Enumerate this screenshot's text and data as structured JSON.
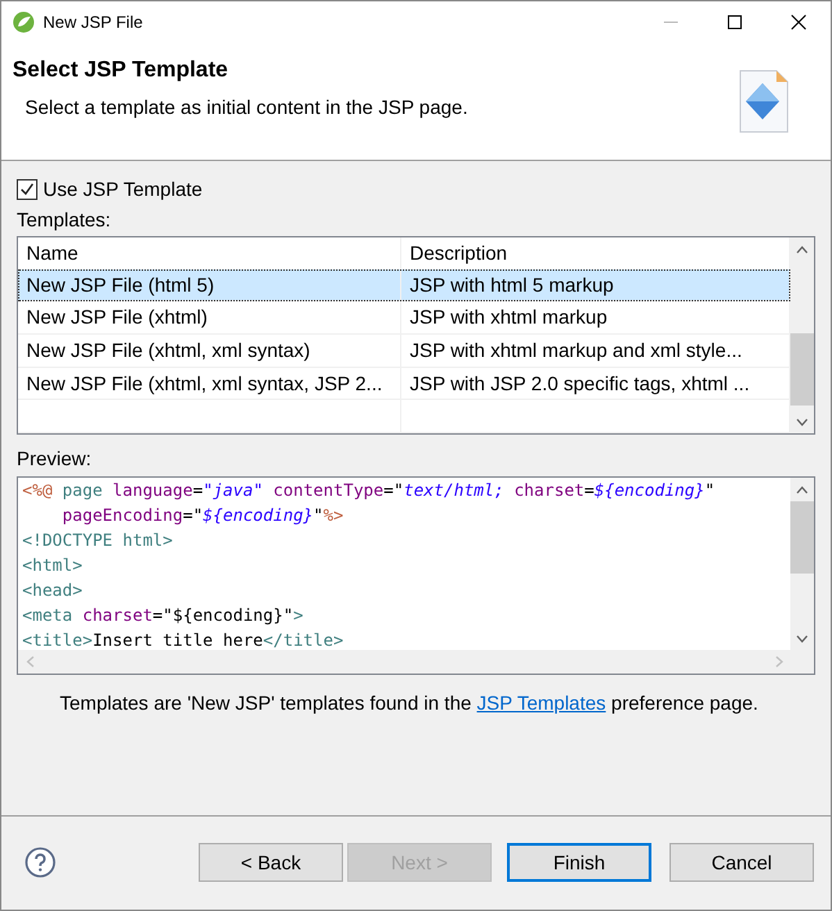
{
  "window": {
    "title": "New JSP File"
  },
  "header": {
    "title": "Select JSP Template",
    "description": "Select a template as initial content in the JSP page."
  },
  "use_template": {
    "label": "Use JSP Template",
    "checked": true
  },
  "templates": {
    "label": "Templates:",
    "columns": [
      "Name",
      "Description"
    ],
    "rows": [
      {
        "name": "New JSP File (html 5)",
        "description": "JSP with html 5 markup",
        "selected": true
      },
      {
        "name": "New JSP File (xhtml)",
        "description": "JSP with xhtml markup",
        "selected": false
      },
      {
        "name": "New JSP File (xhtml, xml syntax)",
        "description": "JSP with xhtml markup and xml style...",
        "selected": false
      },
      {
        "name": "New JSP File (xhtml, xml syntax, JSP 2...",
        "description": "JSP with JSP 2.0 specific tags, xhtml ...",
        "selected": false
      }
    ]
  },
  "preview": {
    "label": "Preview:",
    "lines": [
      [
        {
          "text": "<%@",
          "kind": "delim"
        },
        {
          "text": " page",
          "kind": "tag"
        },
        {
          "text": " language",
          "kind": "attr"
        },
        {
          "text": "=",
          "kind": "plain"
        },
        {
          "text": "\"java\"",
          "kind": "value"
        },
        {
          "text": " contentType",
          "kind": "attr"
        },
        {
          "text": "=\"",
          "kind": "plain"
        },
        {
          "text": "text/html;",
          "kind": "value"
        },
        {
          "text": " charset",
          "kind": "attr"
        },
        {
          "text": "=",
          "kind": "plain"
        },
        {
          "text": "${encoding}",
          "kind": "value"
        },
        {
          "text": "\"",
          "kind": "plain"
        }
      ],
      [
        {
          "text": "    pageEncoding",
          "kind": "attr"
        },
        {
          "text": "=\"",
          "kind": "plain"
        },
        {
          "text": "${encoding}",
          "kind": "value"
        },
        {
          "text": "\"",
          "kind": "plain"
        },
        {
          "text": "%>",
          "kind": "delim"
        }
      ],
      [
        {
          "text": "<!DOCTYPE html>",
          "kind": "tag"
        }
      ],
      [
        {
          "text": "<html>",
          "kind": "tag"
        }
      ],
      [
        {
          "text": "<head>",
          "kind": "tag"
        }
      ],
      [
        {
          "text": "<meta",
          "kind": "tag"
        },
        {
          "text": " charset",
          "kind": "attr"
        },
        {
          "text": "=\"${encoding}\"",
          "kind": "plain"
        },
        {
          "text": ">",
          "kind": "tag"
        }
      ],
      [
        {
          "text": "<title>",
          "kind": "tag"
        },
        {
          "text": "Insert title here",
          "kind": "plain"
        },
        {
          "text": "</title>",
          "kind": "tag"
        }
      ]
    ]
  },
  "note": {
    "before": "Templates are 'New JSP' templates found in the ",
    "link": "JSP Templates",
    "after": " preference page."
  },
  "buttons": [
    {
      "label": "< Back",
      "disabled": false,
      "default": false
    },
    {
      "label": "Next >",
      "disabled": true,
      "default": false
    },
    {
      "label": "Finish",
      "disabled": false,
      "default": true
    },
    {
      "label": "Cancel",
      "disabled": false,
      "default": false
    }
  ]
}
